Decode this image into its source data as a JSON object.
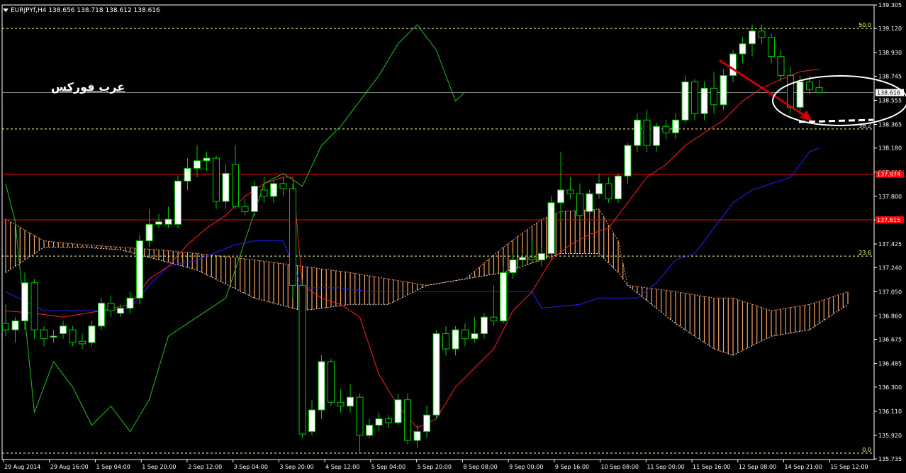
{
  "header": {
    "symbol": "EURJPYf,H4",
    "ohlc": "138.656 138.718 138.612 138.616"
  },
  "watermark": "عرب فوركس",
  "colors": {
    "background": "#000000",
    "grid": "#ffffff",
    "bull": "#ffffff",
    "bear": "#ffffff",
    "candle_border": "#00c800",
    "tenkan": "#ff2020",
    "kijun": "#2020ff",
    "chikou": "#20c020",
    "span_a": "#f4a460",
    "span_b": "#ffe4e1",
    "fibo": "#ffff80",
    "hline": "#ff0000",
    "arrow": "#cc0000",
    "circle": "#ffffff"
  },
  "chart_data": {
    "type": "candlestick",
    "title": "EURJPYf,H4",
    "ylim": [
      135.73,
      139.305
    ],
    "y_ticks": [
      "139.305",
      "139.120",
      "138.930",
      "138.745",
      "138.555",
      "138.365",
      "138.180",
      "137.990",
      "137.800",
      "137.615",
      "137.425",
      "137.240",
      "137.050",
      "136.860",
      "136.675",
      "136.485",
      "136.300",
      "136.110",
      "135.920",
      "135.735"
    ],
    "x_labels": [
      "29 Aug 2014",
      "29 Aug 16:00",
      "1 Sep 04:00",
      "1 Sep 20:00",
      "2 Sep 12:00",
      "3 Sep 04:00",
      "3 Sep 20:00",
      "4 Sep 12:00",
      "5 Sep 04:00",
      "5 Sep 20:00",
      "8 Sep 08:00",
      "9 Sep 00:00",
      "9 Sep 16:00",
      "10 Sep 08:00",
      "11 Sep 00:00",
      "11 Sep 16:00",
      "12 Sep 08:00",
      "14 Sep 21:00",
      "15 Sep 12:00"
    ],
    "current_price": "138.616",
    "hline_labels": [
      "137.974",
      "137.615"
    ],
    "fibo_levels": [
      {
        "label": "50.0",
        "value": 139.12
      },
      {
        "label": "38.2",
        "value": 138.33
      },
      {
        "label": "23.6",
        "value": 137.33
      },
      {
        "label": "0.0",
        "value": 135.78
      }
    ],
    "red_lines": [
      137.974,
      137.615
    ],
    "candles": [
      {
        "o": 136.8,
        "h": 136.95,
        "l": 136.7,
        "c": 136.75
      },
      {
        "o": 136.75,
        "h": 136.85,
        "l": 136.65,
        "c": 136.82
      },
      {
        "o": 136.82,
        "h": 137.2,
        "l": 136.75,
        "c": 137.12
      },
      {
        "o": 137.12,
        "h": 137.15,
        "l": 136.68,
        "c": 136.75
      },
      {
        "o": 136.75,
        "h": 136.78,
        "l": 136.62,
        "c": 136.68
      },
      {
        "o": 136.7,
        "h": 136.75,
        "l": 136.65,
        "c": 136.7
      },
      {
        "o": 136.72,
        "h": 136.82,
        "l": 136.68,
        "c": 136.78
      },
      {
        "o": 136.75,
        "h": 136.78,
        "l": 136.62,
        "c": 136.65
      },
      {
        "o": 136.66,
        "h": 136.72,
        "l": 136.6,
        "c": 136.64
      },
      {
        "o": 136.65,
        "h": 136.82,
        "l": 136.62,
        "c": 136.78
      },
      {
        "o": 136.78,
        "h": 137.0,
        "l": 136.75,
        "c": 136.96
      },
      {
        "o": 136.96,
        "h": 137.02,
        "l": 136.85,
        "c": 136.9
      },
      {
        "o": 136.88,
        "h": 136.95,
        "l": 136.85,
        "c": 136.92
      },
      {
        "o": 136.92,
        "h": 137.05,
        "l": 136.88,
        "c": 137.0
      },
      {
        "o": 137.0,
        "h": 137.5,
        "l": 136.95,
        "c": 137.45
      },
      {
        "o": 137.45,
        "h": 137.7,
        "l": 137.4,
        "c": 137.58
      },
      {
        "o": 137.58,
        "h": 137.66,
        "l": 137.55,
        "c": 137.6
      },
      {
        "o": 137.58,
        "h": 137.72,
        "l": 137.55,
        "c": 137.62
      },
      {
        "o": 137.58,
        "h": 137.96,
        "l": 137.55,
        "c": 137.92
      },
      {
        "o": 137.92,
        "h": 138.1,
        "l": 137.85,
        "c": 138.02
      },
      {
        "o": 138.02,
        "h": 138.2,
        "l": 137.95,
        "c": 138.08
      },
      {
        "o": 138.08,
        "h": 138.15,
        "l": 138.0,
        "c": 138.1
      },
      {
        "o": 138.1,
        "h": 138.12,
        "l": 137.7,
        "c": 137.76
      },
      {
        "o": 137.76,
        "h": 138.05,
        "l": 137.7,
        "c": 137.98
      },
      {
        "o": 138.05,
        "h": 138.2,
        "l": 137.7,
        "c": 137.72
      },
      {
        "o": 137.72,
        "h": 137.78,
        "l": 137.65,
        "c": 137.68
      },
      {
        "o": 137.68,
        "h": 137.92,
        "l": 137.65,
        "c": 137.88
      },
      {
        "o": 137.85,
        "h": 137.95,
        "l": 137.75,
        "c": 137.8
      },
      {
        "o": 137.8,
        "h": 137.92,
        "l": 137.75,
        "c": 137.9
      },
      {
        "o": 137.9,
        "h": 137.95,
        "l": 137.8,
        "c": 137.86
      },
      {
        "o": 137.86,
        "h": 137.9,
        "l": 137.0,
        "c": 137.1
      },
      {
        "o": 137.1,
        "h": 137.12,
        "l": 135.9,
        "c": 135.93
      },
      {
        "o": 135.95,
        "h": 136.2,
        "l": 135.92,
        "c": 136.12
      },
      {
        "o": 136.12,
        "h": 136.55,
        "l": 136.05,
        "c": 136.5
      },
      {
        "o": 136.5,
        "h": 136.52,
        "l": 136.15,
        "c": 136.18
      },
      {
        "o": 136.18,
        "h": 136.28,
        "l": 136.1,
        "c": 136.15
      },
      {
        "o": 136.15,
        "h": 136.32,
        "l": 136.1,
        "c": 136.22
      },
      {
        "o": 136.22,
        "h": 136.25,
        "l": 135.78,
        "c": 135.92
      },
      {
        "o": 135.92,
        "h": 136.05,
        "l": 135.9,
        "c": 136.0
      },
      {
        "o": 136.0,
        "h": 136.1,
        "l": 135.95,
        "c": 136.05
      },
      {
        "o": 136.05,
        "h": 136.08,
        "l": 135.98,
        "c": 136.02
      },
      {
        "o": 136.02,
        "h": 136.25,
        "l": 136.0,
        "c": 136.2
      },
      {
        "o": 136.2,
        "h": 136.25,
        "l": 135.85,
        "c": 135.88
      },
      {
        "o": 135.88,
        "h": 136.0,
        "l": 135.82,
        "c": 135.95
      },
      {
        "o": 135.95,
        "h": 136.15,
        "l": 135.9,
        "c": 136.08
      },
      {
        "o": 136.08,
        "h": 136.75,
        "l": 136.05,
        "c": 136.72
      },
      {
        "o": 136.72,
        "h": 136.78,
        "l": 136.55,
        "c": 136.6
      },
      {
        "o": 136.6,
        "h": 136.78,
        "l": 136.55,
        "c": 136.75
      },
      {
        "o": 136.75,
        "h": 136.8,
        "l": 136.62,
        "c": 136.68
      },
      {
        "o": 136.68,
        "h": 136.85,
        "l": 136.65,
        "c": 136.72
      },
      {
        "o": 136.72,
        "h": 136.88,
        "l": 136.68,
        "c": 136.85
      },
      {
        "o": 136.85,
        "h": 137.1,
        "l": 136.78,
        "c": 136.82
      },
      {
        "o": 136.82,
        "h": 137.25,
        "l": 136.8,
        "c": 137.2
      },
      {
        "o": 137.2,
        "h": 137.35,
        "l": 137.15,
        "c": 137.3
      },
      {
        "o": 137.3,
        "h": 137.35,
        "l": 137.25,
        "c": 137.32
      },
      {
        "o": 137.32,
        "h": 137.45,
        "l": 137.28,
        "c": 137.3
      },
      {
        "o": 137.3,
        "h": 137.4,
        "l": 137.25,
        "c": 137.35
      },
      {
        "o": 137.35,
        "h": 137.8,
        "l": 137.3,
        "c": 137.75
      },
      {
        "o": 137.75,
        "h": 138.15,
        "l": 137.6,
        "c": 137.85
      },
      {
        "o": 137.85,
        "h": 137.95,
        "l": 137.78,
        "c": 137.82
      },
      {
        "o": 137.82,
        "h": 137.9,
        "l": 137.6,
        "c": 137.65
      },
      {
        "o": 137.68,
        "h": 137.85,
        "l": 137.6,
        "c": 137.82
      },
      {
        "o": 137.82,
        "h": 137.98,
        "l": 137.78,
        "c": 137.9
      },
      {
        "o": 137.9,
        "h": 137.95,
        "l": 137.75,
        "c": 137.78
      },
      {
        "o": 137.78,
        "h": 137.98,
        "l": 137.75,
        "c": 137.96
      },
      {
        "o": 137.96,
        "h": 138.22,
        "l": 137.9,
        "c": 138.2
      },
      {
        "o": 138.2,
        "h": 138.45,
        "l": 138.15,
        "c": 138.4
      },
      {
        "o": 138.4,
        "h": 138.48,
        "l": 138.15,
        "c": 138.2
      },
      {
        "o": 138.2,
        "h": 138.38,
        "l": 138.15,
        "c": 138.35
      },
      {
        "o": 138.35,
        "h": 138.4,
        "l": 138.25,
        "c": 138.3
      },
      {
        "o": 138.3,
        "h": 138.45,
        "l": 138.25,
        "c": 138.4
      },
      {
        "o": 138.4,
        "h": 138.75,
        "l": 138.38,
        "c": 138.7
      },
      {
        "o": 138.7,
        "h": 138.72,
        "l": 138.4,
        "c": 138.45
      },
      {
        "o": 138.45,
        "h": 138.7,
        "l": 138.4,
        "c": 138.65
      },
      {
        "o": 138.65,
        "h": 138.78,
        "l": 138.45,
        "c": 138.52
      },
      {
        "o": 138.52,
        "h": 138.8,
        "l": 138.48,
        "c": 138.75
      },
      {
        "o": 138.75,
        "h": 138.95,
        "l": 138.7,
        "c": 138.92
      },
      {
        "o": 138.92,
        "h": 139.05,
        "l": 138.85,
        "c": 139.0
      },
      {
        "o": 139.0,
        "h": 139.15,
        "l": 138.9,
        "c": 139.1
      },
      {
        "o": 139.1,
        "h": 139.15,
        "l": 139.0,
        "c": 139.05
      },
      {
        "o": 139.05,
        "h": 139.08,
        "l": 138.85,
        "c": 138.9
      },
      {
        "o": 138.9,
        "h": 138.95,
        "l": 138.7,
        "c": 138.75
      },
      {
        "o": 138.75,
        "h": 138.82,
        "l": 138.45,
        "c": 138.5
      },
      {
        "o": 138.5,
        "h": 138.75,
        "l": 138.45,
        "c": 138.7
      },
      {
        "o": 138.7,
        "h": 138.75,
        "l": 138.6,
        "c": 138.64
      },
      {
        "o": 138.656,
        "h": 138.718,
        "l": 138.612,
        "c": 138.616
      }
    ],
    "tenkan": [
      [
        0,
        136.9
      ],
      [
        3,
        136.88
      ],
      [
        6,
        136.85
      ],
      [
        10,
        136.9
      ],
      [
        13,
        136.95
      ],
      [
        15,
        137.15
      ],
      [
        17,
        137.25
      ],
      [
        19,
        137.42
      ],
      [
        21,
        137.55
      ],
      [
        23,
        137.65
      ],
      [
        25,
        137.8
      ],
      [
        27,
        137.9
      ],
      [
        29,
        137.95
      ],
      [
        30,
        137.95
      ],
      [
        31,
        137.1
      ],
      [
        33,
        137.0
      ],
      [
        35,
        136.95
      ],
      [
        37,
        136.85
      ],
      [
        39,
        136.4
      ],
      [
        41,
        136.15
      ],
      [
        43,
        135.98
      ],
      [
        45,
        136.05
      ],
      [
        47,
        136.3
      ],
      [
        49,
        136.45
      ],
      [
        51,
        136.6
      ],
      [
        53,
        136.9
      ],
      [
        55,
        137.05
      ],
      [
        57,
        137.3
      ],
      [
        59,
        137.42
      ],
      [
        61,
        137.5
      ],
      [
        63,
        137.55
      ],
      [
        65,
        137.75
      ],
      [
        67,
        137.95
      ],
      [
        69,
        138.05
      ],
      [
        71,
        138.2
      ],
      [
        73,
        138.3
      ],
      [
        75,
        138.4
      ],
      [
        77,
        138.55
      ],
      [
        79,
        138.65
      ],
      [
        81,
        138.72
      ],
      [
        83,
        138.78
      ],
      [
        85,
        138.8
      ]
    ],
    "kijun": [
      [
        0,
        137.05
      ],
      [
        4,
        136.9
      ],
      [
        10,
        136.9
      ],
      [
        13,
        136.92
      ],
      [
        15,
        137.1
      ],
      [
        17,
        137.25
      ],
      [
        20,
        137.3
      ],
      [
        24,
        137.42
      ],
      [
        26,
        137.45
      ],
      [
        29,
        137.45
      ],
      [
        31,
        137.08
      ],
      [
        35,
        137.08
      ],
      [
        38,
        137.05
      ],
      [
        40,
        137.05
      ],
      [
        45,
        137.05
      ],
      [
        50,
        137.05
      ],
      [
        55,
        137.05
      ],
      [
        56,
        136.92
      ],
      [
        60,
        136.95
      ],
      [
        62,
        137.0
      ],
      [
        66,
        137.0
      ],
      [
        68,
        137.12
      ],
      [
        70,
        137.3
      ],
      [
        72,
        137.35
      ],
      [
        74,
        137.55
      ],
      [
        76,
        137.75
      ],
      [
        78,
        137.85
      ],
      [
        80,
        137.9
      ],
      [
        82,
        137.95
      ],
      [
        84,
        138.15
      ],
      [
        85,
        138.18
      ]
    ],
    "chikou": [
      [
        0,
        137.9
      ],
      [
        1,
        137.6
      ],
      [
        3,
        136.1
      ],
      [
        5,
        136.5
      ],
      [
        7,
        136.3
      ],
      [
        9,
        136.0
      ],
      [
        11,
        136.15
      ],
      [
        13,
        135.95
      ],
      [
        15,
        136.2
      ],
      [
        17,
        136.7
      ],
      [
        19,
        136.8
      ],
      [
        21,
        136.9
      ],
      [
        23,
        137.0
      ],
      [
        25,
        137.45
      ],
      [
        27,
        137.9
      ],
      [
        29,
        137.98
      ],
      [
        31,
        137.88
      ],
      [
        33,
        138.2
      ],
      [
        35,
        138.35
      ],
      [
        37,
        138.55
      ],
      [
        39,
        138.75
      ],
      [
        41,
        139.0
      ],
      [
        43,
        139.15
      ],
      [
        45,
        138.95
      ],
      [
        47,
        138.55
      ],
      [
        48,
        138.62
      ]
    ],
    "cloud": {
      "a": [
        [
          0,
          137.62
        ],
        [
          4,
          137.45
        ],
        [
          8,
          137.42
        ],
        [
          12,
          137.4
        ],
        [
          16,
          137.38
        ],
        [
          20,
          137.35
        ],
        [
          26,
          137.3
        ],
        [
          31,
          137.25
        ],
        [
          36,
          137.2
        ],
        [
          40,
          137.15
        ],
        [
          44,
          137.1
        ],
        [
          48,
          137.15
        ],
        [
          52,
          137.4
        ],
        [
          56,
          137.62
        ],
        [
          58,
          137.68
        ],
        [
          62,
          137.7
        ],
        [
          64,
          137.45
        ],
        [
          65,
          137.1
        ],
        [
          70,
          137.05
        ],
        [
          74,
          137.0
        ],
        [
          76,
          137.0
        ],
        [
          80,
          136.9
        ],
        [
          84,
          136.95
        ],
        [
          88,
          137.05
        ]
      ],
      "b": [
        [
          0,
          137.2
        ],
        [
          4,
          137.4
        ],
        [
          8,
          137.4
        ],
        [
          12,
          137.38
        ],
        [
          16,
          137.3
        ],
        [
          20,
          137.22
        ],
        [
          26,
          137.0
        ],
        [
          31,
          136.9
        ],
        [
          36,
          136.95
        ],
        [
          40,
          136.95
        ],
        [
          44,
          137.1
        ],
        [
          48,
          137.15
        ],
        [
          52,
          137.2
        ],
        [
          56,
          137.3
        ],
        [
          58,
          137.35
        ],
        [
          62,
          137.35
        ],
        [
          64,
          137.2
        ],
        [
          65,
          137.1
        ],
        [
          70,
          136.8
        ],
        [
          74,
          136.6
        ],
        [
          76,
          136.55
        ],
        [
          80,
          136.7
        ],
        [
          84,
          136.75
        ],
        [
          88,
          136.95
        ]
      ]
    }
  }
}
